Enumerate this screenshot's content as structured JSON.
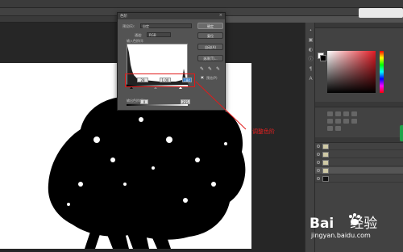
{
  "app": {
    "menu": [
      "",
      "",
      "",
      "",
      "",
      "",
      "",
      "",
      "",
      "",
      ""
    ],
    "doc_tab": "",
    "doc_tab_close": "×"
  },
  "levels_dialog": {
    "title": "色阶",
    "close": "×",
    "preset_label": "预设(E):",
    "preset_value": "自定",
    "channel_label": "通道:",
    "channel_value": "RGB",
    "input_levels_label": "输入色阶(I):",
    "input_black": "28",
    "input_gamma": "1.00",
    "input_white": "184",
    "output_levels_label": "输出色阶(O):",
    "output_black": "0",
    "output_white": "255",
    "ok_label": "确定",
    "reset_label": "复位",
    "auto_label": "自动(A)",
    "options_label": "选项(T)...",
    "preview_label": "预览(P)"
  },
  "annotation": {
    "text": "调整色阶",
    "color": "#e01b1b"
  },
  "layers_panel": {
    "rows": [
      {
        "name": "",
        "meta": ""
      },
      {
        "name": "",
        "meta": ""
      },
      {
        "name": "",
        "meta": ""
      },
      {
        "name": "",
        "meta": ""
      },
      {
        "name": "",
        "meta": ""
      }
    ]
  },
  "watermark": {
    "brand": "Bai",
    "brand_suffix": "经验",
    "url": "jingyan.baidu.com"
  },
  "colors": {
    "accent_blue": "#2b78c7",
    "annotation_red": "#e01b1b",
    "workspace": "#535353"
  }
}
